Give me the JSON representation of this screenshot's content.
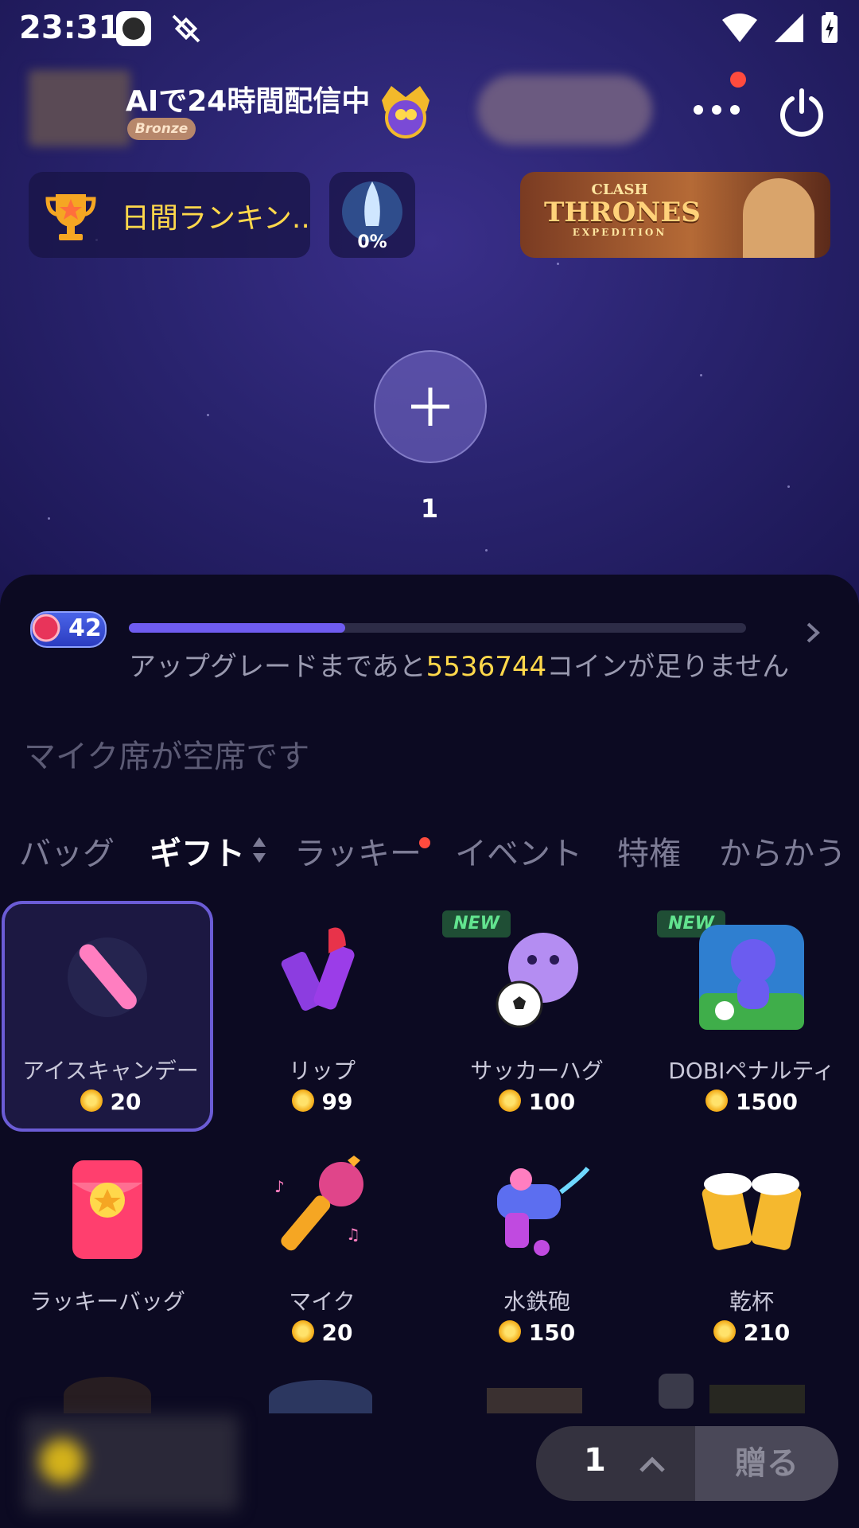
{
  "status_bar": {
    "time": "23:31"
  },
  "room": {
    "title": "AIで24時間配信中",
    "tier_badge": "Bronze"
  },
  "header": {
    "ranking_label": "日間ランキン..",
    "rocket_progress": "0%",
    "banner_line1": "CLASH",
    "banner_line2": "THRONES",
    "banner_line3": "EXPEDITION"
  },
  "seat": {
    "number": "1"
  },
  "level": {
    "value": "42",
    "progress_fraction": 0.35,
    "upgrade_prefix": "アップグレードまであと",
    "upgrade_coins": "5536744",
    "upgrade_suffix": "コインが足りません"
  },
  "mic_status": "マイク席が空席です",
  "tabs": [
    {
      "label": "バッグ"
    },
    {
      "label": "ギフト"
    },
    {
      "label": "ラッキー"
    },
    {
      "label": "イベント"
    },
    {
      "label": "特権"
    },
    {
      "label": "からかう"
    }
  ],
  "new_badge": "NEW",
  "gifts": [
    {
      "name": "アイスキャンデー",
      "price": "20",
      "icon": "ice-candy-icon"
    },
    {
      "name": "リップ",
      "price": "99",
      "icon": "lipstick-icon"
    },
    {
      "name": "サッカーハグ",
      "price": "100",
      "icon": "soccer-hug-icon"
    },
    {
      "name": "DOBIペナルティ",
      "price": "1500",
      "icon": "dobi-penalty-icon"
    },
    {
      "name": "ラッキーバッグ",
      "price": "",
      "icon": "lucky-bag-icon"
    },
    {
      "name": "マイク",
      "price": "20",
      "icon": "microphone-icon"
    },
    {
      "name": "水鉄砲",
      "price": "150",
      "icon": "water-gun-icon"
    },
    {
      "name": "乾杯",
      "price": "210",
      "icon": "beer-cheers-icon"
    }
  ],
  "send_bar": {
    "quantity": "1",
    "send_label": "贈る"
  },
  "colors": {
    "accent": "#6f5cf0",
    "coin_text": "#ffd84b",
    "new_green": "#62e38f"
  }
}
